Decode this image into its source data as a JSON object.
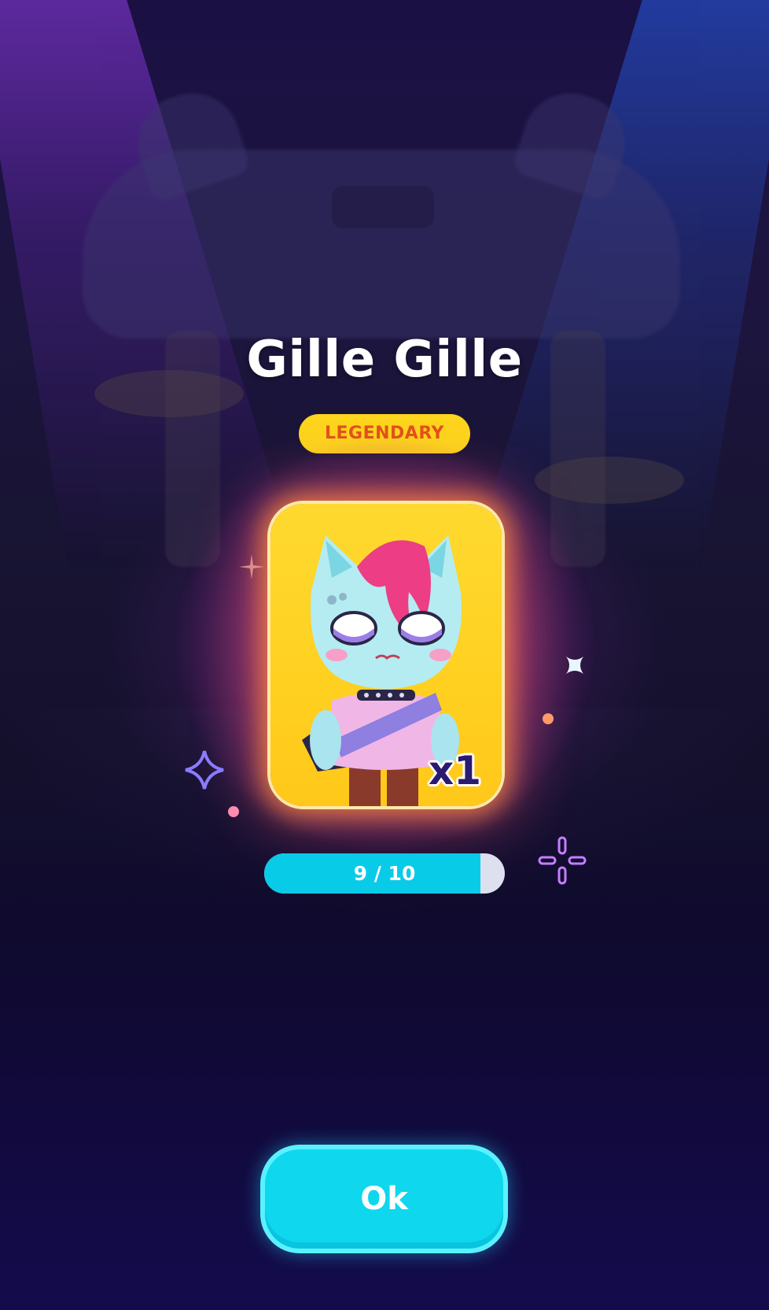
{
  "character": {
    "name": "Gille Gille",
    "rarity": "LEGENDARY",
    "count_label": "x1"
  },
  "progress": {
    "current": 9,
    "total": 10,
    "label": "9 / 10"
  },
  "buttons": {
    "ok_label": "Ok"
  },
  "colors": {
    "rarity_badge": "#fdd51c",
    "rarity_text": "#e0521c",
    "card_background": "#ffd930",
    "progress_fill": "#08cbe8",
    "progress_track": "#dde0ef",
    "ok_button": "#0fd7ee"
  },
  "icons": {
    "sparkle_left": "four-point-star-icon",
    "sparkle_right": "dotted-cross-sparkle-icon",
    "sparkle_small": "x-sparkle-icon"
  }
}
